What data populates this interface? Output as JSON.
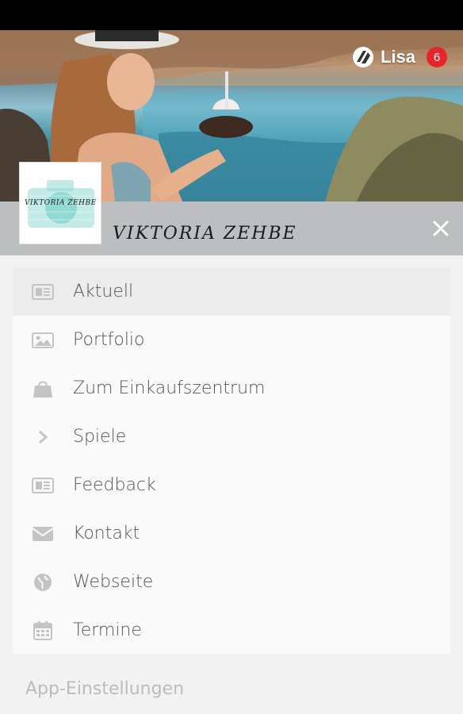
{
  "header": {
    "user_name": "Lisa",
    "notification_count": "6",
    "brand_name": "VIKTORIA ZEHBE",
    "logo_text": "VIKTORIA ZEHBE"
  },
  "menu": {
    "items": [
      {
        "label": "Aktuell",
        "icon": "newspaper-icon"
      },
      {
        "label": "Portfolio",
        "icon": "image-icon"
      },
      {
        "label": "Zum Einkaufszentrum",
        "icon": "shopping-bag-icon"
      },
      {
        "label": "Spiele",
        "icon": "chevron-right-icon"
      },
      {
        "label": "Feedback",
        "icon": "newspaper-icon"
      },
      {
        "label": "Kontakt",
        "icon": "envelope-icon"
      },
      {
        "label": "Webseite",
        "icon": "globe-icon"
      },
      {
        "label": "Termine",
        "icon": "calendar-icon"
      }
    ],
    "active_index": 0
  },
  "footer": {
    "settings_label": "App-Einstellungen"
  },
  "colors": {
    "status_bar": "#000000",
    "brand_bar": "#bdbebf",
    "badge": "#e8252a",
    "menu_text": "#555555",
    "icon": "#c4c4c4"
  }
}
